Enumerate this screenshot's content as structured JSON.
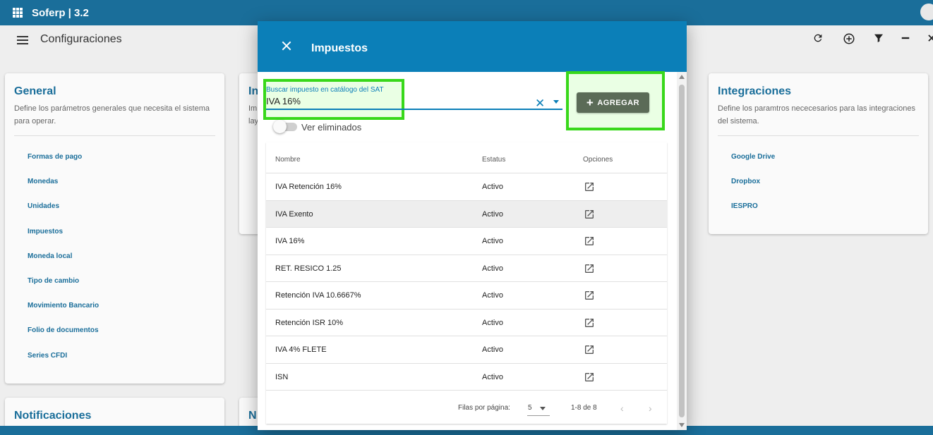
{
  "app": {
    "title": "Soferp | 3.2"
  },
  "toolbar": {
    "page_title": "Configuraciones",
    "icons": [
      "refresh-icon",
      "add-circle-icon",
      "filter-icon",
      "minimize-icon",
      "close-icon"
    ]
  },
  "cards": {
    "general": {
      "title": "General",
      "description": "Define los parámetros generales que necesita el sistema para operar.",
      "items": [
        "Formas de pago",
        "Monedas",
        "Unidades",
        "Impuestos",
        "Moneda local",
        "Tipo de cambio",
        "Movimiento Bancario",
        "Folio de documentos",
        "Series CFDI"
      ]
    },
    "second": {
      "title_fragment": "In",
      "desc_fragment_1": "Im",
      "desc_fragment_2": "lay"
    },
    "integraciones": {
      "title": "Integraciones",
      "description": "Define los paramtros nececesarios para las integraciones del sistema.",
      "items": [
        "Google Drive",
        "Dropbox",
        "IESPRO"
      ]
    },
    "notificaciones": {
      "title": "Notificaciones"
    },
    "fourth": {
      "title_fragment": "N"
    }
  },
  "modal": {
    "title": "Impuestos",
    "search": {
      "label": "Buscar impuesto en catálogo del SAT",
      "value": "IVA 16%"
    },
    "add_button": "AGREGAR",
    "toggle_label": "Ver eliminados",
    "table": {
      "headers": {
        "name": "Nombre",
        "status": "Estatus",
        "options": "Opciones"
      },
      "rows": [
        {
          "name": "IVA Retención 16%",
          "status": "Activo"
        },
        {
          "name": "IVA Exento",
          "status": "Activo"
        },
        {
          "name": "IVA 16%",
          "status": "Activo"
        },
        {
          "name": "RET. RESICO 1.25",
          "status": "Activo"
        },
        {
          "name": "Retención IVA 10.6667%",
          "status": "Activo"
        },
        {
          "name": "Retención ISR 10%",
          "status": "Activo"
        },
        {
          "name": "IVA 4% FLETE",
          "status": "Activo"
        },
        {
          "name": "ISN",
          "status": "Activo"
        }
      ]
    },
    "pagination": {
      "rows_per_page_label": "Filas por página:",
      "rows_per_page": "5",
      "range": "1-8 de 8"
    }
  },
  "colors": {
    "brand": "#1a6e9a",
    "modal_header": "#0b7fb8",
    "highlight": "#38d81a",
    "add_button": "#5b6b57"
  }
}
